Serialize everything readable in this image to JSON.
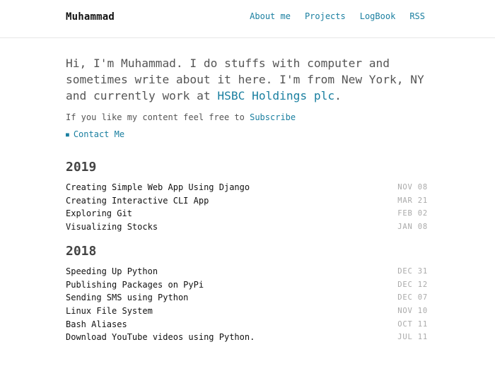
{
  "header": {
    "site_title": "Muhammad",
    "nav": [
      "About me",
      "Projects",
      "LogBook",
      "RSS"
    ]
  },
  "intro": {
    "text_before": "Hi, I'm Muhammad. I do stuffs with computer and sometimes write about it here. I'm from New York, NY and currently work at ",
    "employer": "HSBC Holdings plc",
    "text_after": "."
  },
  "subscribe": {
    "text": "If you like my content feel free to ",
    "link": "Subscribe"
  },
  "contact": {
    "link": "Contact Me"
  },
  "years": [
    {
      "year": "2019",
      "posts": [
        {
          "title": "Creating Simple Web App Using Django",
          "date": "NOV 08"
        },
        {
          "title": "Creating Interactive CLI App",
          "date": "MAR 21"
        },
        {
          "title": "Exploring Git",
          "date": "FEB 02"
        },
        {
          "title": "Visualizing Stocks",
          "date": "JAN 08"
        }
      ]
    },
    {
      "year": "2018",
      "posts": [
        {
          "title": "Speeding Up Python",
          "date": "DEC 31"
        },
        {
          "title": "Publishing Packages on PyPi",
          "date": "DEC 12"
        },
        {
          "title": "Sending SMS using Python",
          "date": "DEC 07"
        },
        {
          "title": "Linux File System",
          "date": "NOV 10"
        },
        {
          "title": "Bash Aliases",
          "date": "OCT 11"
        },
        {
          "title": "Download YouTube videos using Python.",
          "date": "JUL 11"
        }
      ]
    }
  ],
  "colors": {
    "accent": "#1a7fa0",
    "text": "#555555",
    "date": "#aaaaaa"
  }
}
